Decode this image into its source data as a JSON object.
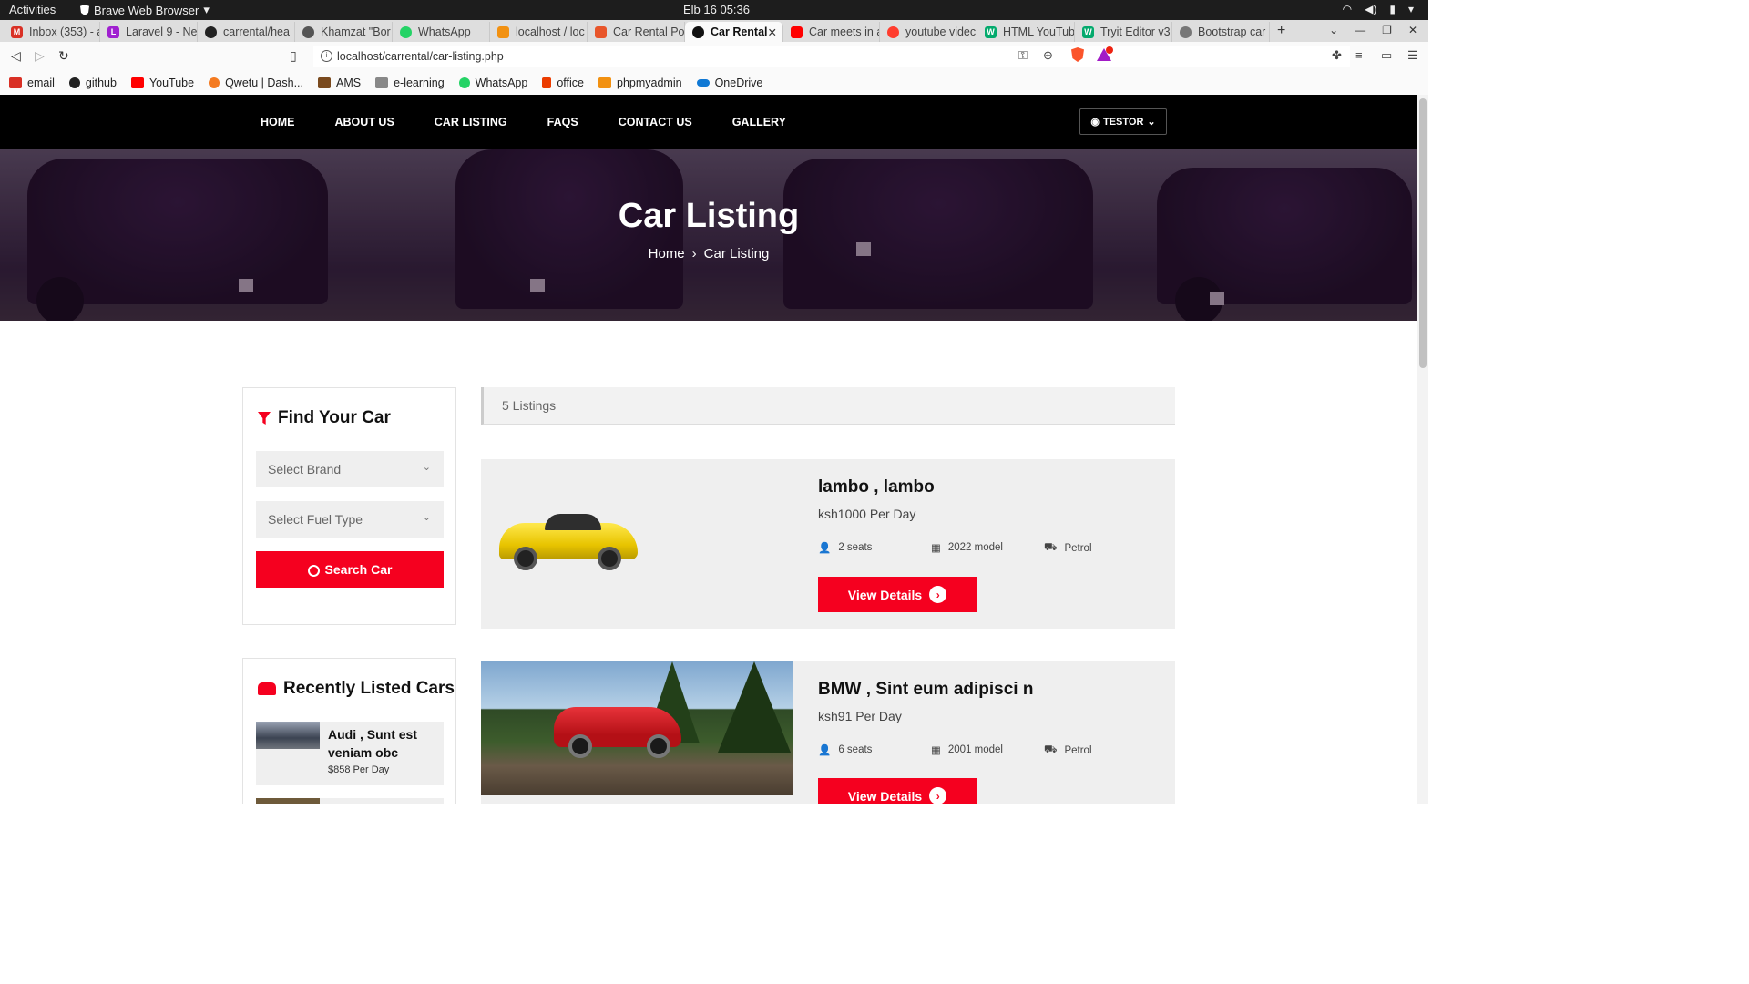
{
  "topbar": {
    "activities": "Activities",
    "app_menu": "Brave Web Browser",
    "clock": "Elb 16  05:36"
  },
  "tabs": [
    {
      "label": "Inbox (353) - a",
      "color": "#d93025",
      "glyph": "M"
    },
    {
      "label": "Laravel 9 - Ne",
      "color": "#a020d0",
      "glyph": "L"
    },
    {
      "label": "carrental/hea",
      "color": "#222222",
      "glyph": ""
    },
    {
      "label": "Khamzat \"Bor",
      "color": "#555555",
      "glyph": ""
    },
    {
      "label": "WhatsApp",
      "color": "#25d366",
      "glyph": ""
    },
    {
      "label": "localhost / loc",
      "color": "#f29111",
      "glyph": ""
    },
    {
      "label": "Car Rental Po",
      "color": "#e8552a",
      "glyph": ""
    },
    {
      "label": "Car Rental",
      "color": "#111111",
      "glyph": ""
    },
    {
      "label": "Car meets in a",
      "color": "#ff0000",
      "glyph": ""
    },
    {
      "label": "youtube videc",
      "color": "#ff3d2e",
      "glyph": ""
    },
    {
      "label": "HTML YouTub",
      "color": "#04aa6d",
      "glyph": "W"
    },
    {
      "label": "Tryit Editor v3",
      "color": "#04aa6d",
      "glyph": "W"
    },
    {
      "label": "Bootstrap car",
      "color": "#777777",
      "glyph": ""
    }
  ],
  "address": {
    "url": "localhost/carrental/car-listing.php"
  },
  "bookmarks": [
    {
      "label": "email",
      "color": "#d93025"
    },
    {
      "label": "github",
      "color": "#222222"
    },
    {
      "label": "YouTube",
      "color": "#ff0000"
    },
    {
      "label": "Qwetu | Dash...",
      "color": "#f47a20"
    },
    {
      "label": "AMS",
      "color": "#7a4a1e"
    },
    {
      "label": "e-learning",
      "color": "#888888"
    },
    {
      "label": "WhatsApp",
      "color": "#25d366"
    },
    {
      "label": "office",
      "color": "#eb3c00"
    },
    {
      "label": "phpmyadmin",
      "color": "#f29111"
    },
    {
      "label": "OneDrive",
      "color": "#0f78d4"
    }
  ],
  "site": {
    "nav": [
      "HOME",
      "ABOUT US",
      "CAR LISTING",
      "FAQS",
      "CONTACT US",
      "GALLERY"
    ],
    "user": "TESTOR",
    "hero": {
      "title": "Car Listing",
      "crumb_home": "Home",
      "crumb_current": "Car Listing"
    }
  },
  "sidebar": {
    "find_title": "Find Your Car",
    "brand_placeholder": "Select Brand",
    "fuel_placeholder": "Select Fuel Type",
    "search_label": "Search Car",
    "recent_title": "Recently Listed Cars",
    "recent": [
      {
        "name": "Audi , Sunt est veniam obc",
        "price": "$858 Per Day"
      }
    ]
  },
  "listings": {
    "count": "5 Listings",
    "items": [
      {
        "title": "lambo , lambo",
        "price": "ksh1000 Per Day",
        "seats": "2 seats",
        "model": "2022 model",
        "fuel": "Petrol",
        "button": "View Details"
      },
      {
        "title": "BMW , Sint eum adipisci n",
        "price": "ksh91 Per Day",
        "seats": "6 seats",
        "model": "2001 model",
        "fuel": "Petrol",
        "button": "View Details"
      }
    ]
  },
  "colors": {
    "accent": "#f5001f",
    "nav_bg": "#000000",
    "card_bg": "#efefef"
  }
}
